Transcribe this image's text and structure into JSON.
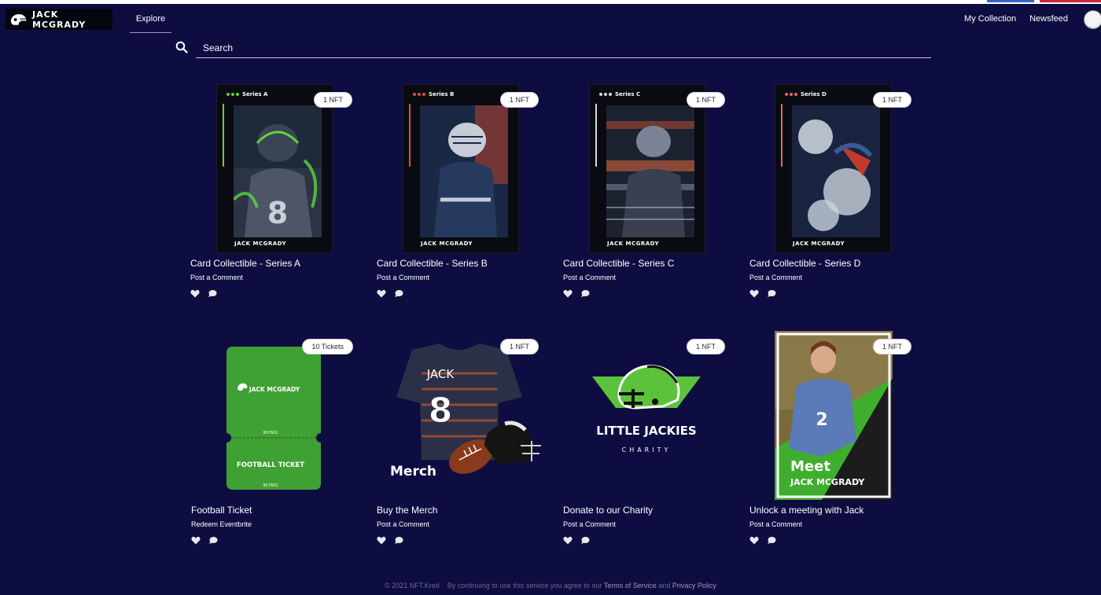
{
  "brand": {
    "name": "JACK MCGRADY"
  },
  "nav": {
    "explore": "Explore",
    "my_collection": "My Collection",
    "newsfeed": "Newsfeed"
  },
  "search": {
    "placeholder": "Search",
    "icon": "search-icon"
  },
  "colors": {
    "background": "#0d0d42",
    "ticket_green": "#3fa033",
    "accent_green": "#5cc23c"
  },
  "items": [
    {
      "title": "Card Collectible - Series A",
      "subtitle": "Post a Comment",
      "badge": "1 NFT",
      "series": "Series A",
      "name": "JACK MCGRADY",
      "accent": "#5fd43c"
    },
    {
      "title": "Card Collectible - Series B",
      "subtitle": "Post a Comment",
      "badge": "1 NFT",
      "series": "Series B",
      "name": "JACK MCGRADY",
      "accent": "#e0533a"
    },
    {
      "title": "Card Collectible - Series C",
      "subtitle": "Post a Comment",
      "badge": "1 NFT",
      "series": "Series C",
      "name": "JACK MCGRADY",
      "accent": "#d9d9e6"
    },
    {
      "title": "Card Collectible - Series D",
      "subtitle": "Post a Comment",
      "badge": "1 NFT",
      "series": "Series D",
      "name": "JACK MCGRADY",
      "accent": "#e06a5a"
    },
    {
      "title": "Football Ticket",
      "subtitle": "Redeem Eventbrite",
      "badge": "10 Tickets",
      "brand": "JACK MCGRADY",
      "ticket_no": "957602",
      "ticket_label": "FOOTBALL TICKET"
    },
    {
      "title": "Buy the Merch",
      "subtitle": "Post a Comment",
      "badge": "1 NFT",
      "jersey_name": "JACK",
      "jersey_number": "8",
      "label": "Merch"
    },
    {
      "title": "Donate to our Charity",
      "subtitle": "Post a Comment",
      "badge": "1 NFT",
      "charity_name": "LITTLE JACKIES",
      "charity_sub": "CHARITY"
    },
    {
      "title": "Unlock a meeting with Jack",
      "subtitle": "Post a Comment",
      "badge": "1 NFT",
      "meet": "Meet",
      "meet_name": "JACK MCGRADY"
    }
  ],
  "footer": {
    "copyright": "© 2021 NFT.Kred",
    "text": "By continuing to use this service you agree to our",
    "terms": "Terms of Service",
    "and": "and",
    "privacy": "Privacy Policy"
  }
}
